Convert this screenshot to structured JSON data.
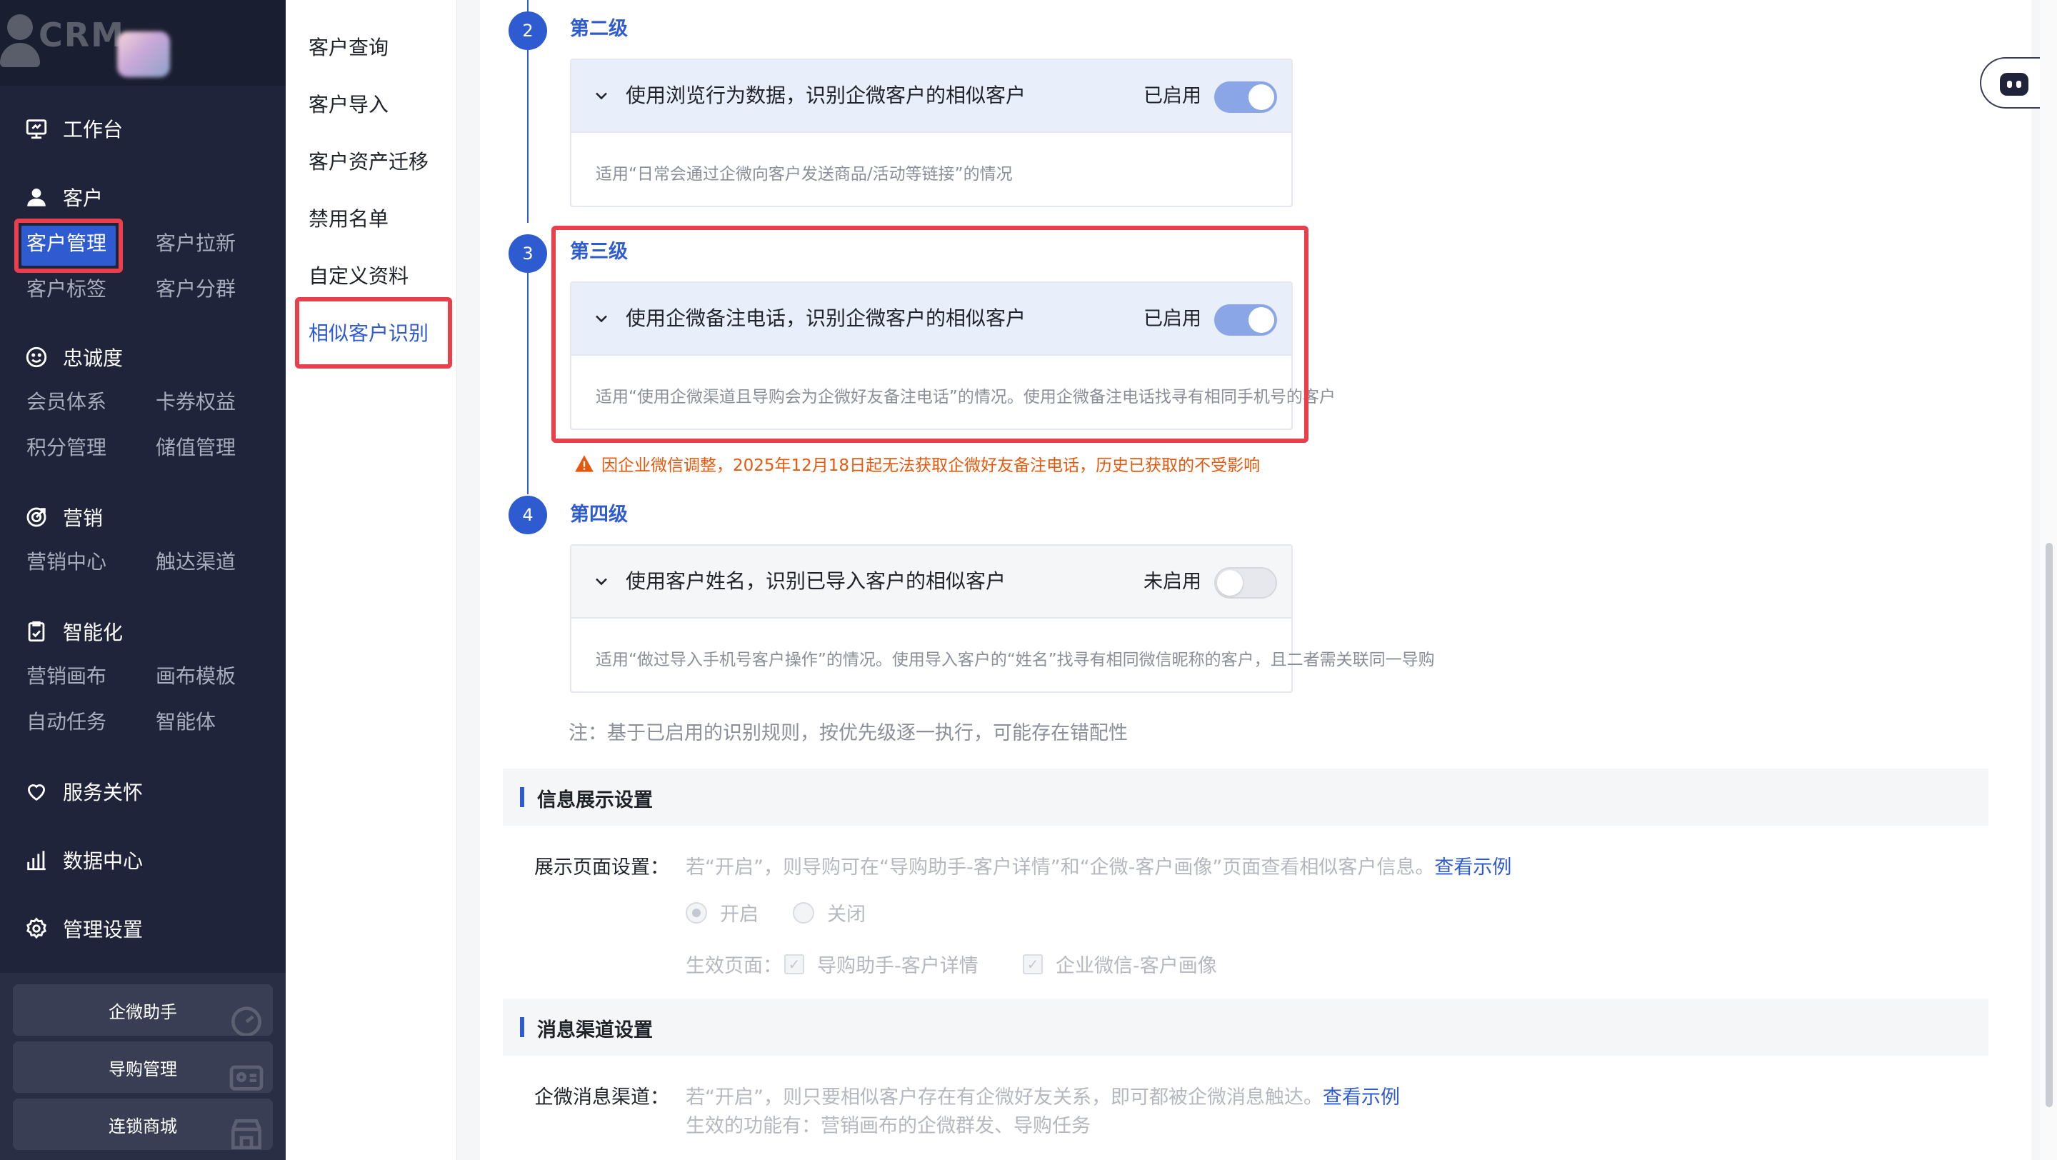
{
  "sidebar": {
    "logo_text": "CRM",
    "workbench": "工作台",
    "customer": {
      "title": "客户",
      "items": [
        "客户管理",
        "客户拉新",
        "客户标签",
        "客户分群"
      ]
    },
    "loyalty": {
      "title": "忠诚度",
      "items": [
        "会员体系",
        "卡券权益",
        "积分管理",
        "储值管理"
      ]
    },
    "marketing": {
      "title": "营销",
      "items": [
        "营销中心",
        "触达渠道"
      ]
    },
    "intelligence": {
      "title": "智能化",
      "items": [
        "营销画布",
        "画布模板",
        "自动任务",
        "智能体"
      ]
    },
    "service": "服务关怀",
    "data_center": "数据中心",
    "settings": "管理设置",
    "tools": [
      "企微助手",
      "导购管理",
      "连锁商城"
    ]
  },
  "submenu": {
    "items": [
      "客户查询",
      "客户导入",
      "客户资产迁移",
      "禁用名单",
      "自定义资料",
      "相似客户识别"
    ]
  },
  "levels": [
    {
      "step": "2",
      "title": "第二级",
      "rule": "使用浏览行为数据，识别企微客户的相似客户",
      "status": "已启用",
      "enabled": true,
      "desc": "适用“日常会通过企微向客户发送商品/活动等链接”的情况"
    },
    {
      "step": "3",
      "title": "第三级",
      "rule": "使用企微备注电话，识别企微客户的相似客户",
      "status": "已启用",
      "enabled": true,
      "desc": "适用“使用企微渠道且导购会为企微好友备注电话”的情况。使用企微备注电话找寻有相同手机号的客户"
    },
    {
      "step": "4",
      "title": "第四级",
      "rule": "使用客户姓名，识别已导入客户的相似客户",
      "status": "未启用",
      "enabled": false,
      "desc": "适用“做过导入手机号客户操作”的情况。使用导入客户的“姓名”找寻有相同微信昵称的客户，且二者需关联同一导购"
    }
  ],
  "warning": "因企业微信调整，2025年12月18日起无法获取企微好友备注电话，历史已获取的不受影响",
  "note": "注：基于已启用的识别规则，按优先级逐一执行，可能存在错配性",
  "display_settings": {
    "section_title": "信息展示设置",
    "label": "展示页面设置：",
    "help": "若“开启”，则导购可在“导购助手-客户详情”和“企微-客户画像”页面查看相似客户信息。",
    "link": "查看示例",
    "radio_on": "开启",
    "radio_off": "关闭",
    "effective_label": "生效页面：",
    "pages": [
      "导购助手-客户详情",
      "企业微信-客户画像"
    ]
  },
  "channel_settings": {
    "section_title": "消息渠道设置",
    "label": "企微消息渠道：",
    "help": "若“开启”，则只要相似客户存在有企微好友关系，即可都被企微消息触达。",
    "link": "查看示例",
    "help2": "生效的功能有：营销画布的企微群发、导购任务"
  },
  "colors": {
    "sidebar_bg": "#20243a",
    "accent": "#2f5bd1",
    "highlight_border": "#ea3f4a",
    "warning": "#e8580c",
    "toggle_on": "#8aa6e6"
  }
}
